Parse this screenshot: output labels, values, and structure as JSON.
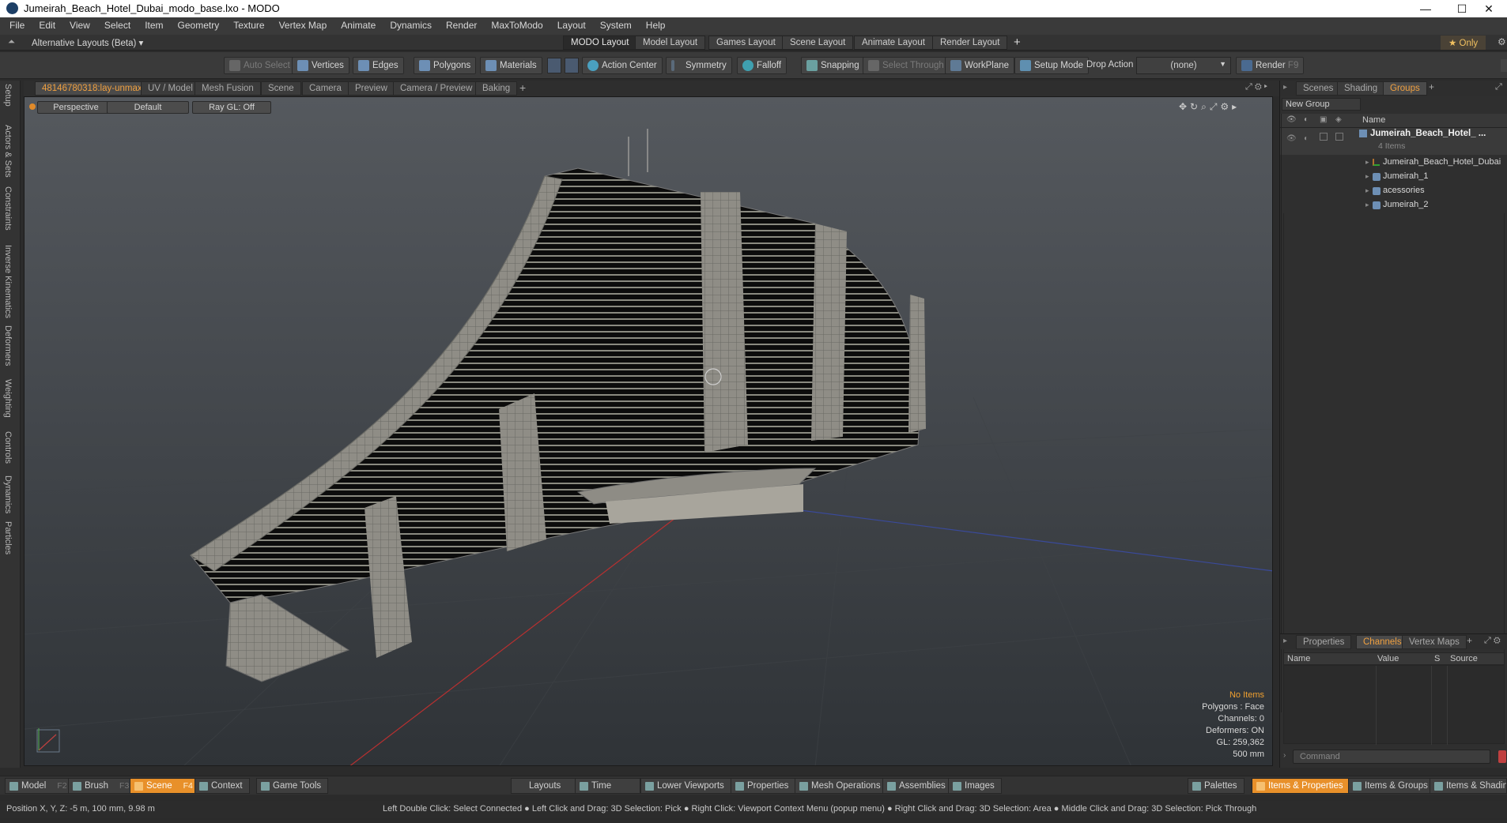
{
  "window": {
    "title": "Jumeirah_Beach_Hotel_Dubai_modo_base.lxo - MODO",
    "min_symbol": "—",
    "max_symbol": "☐",
    "close_symbol": "✕"
  },
  "menu": [
    "File",
    "Edit",
    "View",
    "Select",
    "Item",
    "Geometry",
    "Texture",
    "Vertex Map",
    "Animate",
    "Dynamics",
    "Render",
    "MaxToModo",
    "Layout",
    "System",
    "Help"
  ],
  "layouts": {
    "alt_label": "Alternative Layouts (Beta) ▾",
    "tabs": [
      "MODO Layout",
      "Model Layout",
      "Games Layout",
      "Scene Layout",
      "Animate Layout",
      "Render Layout"
    ],
    "active": "MODO Layout",
    "add": "+",
    "only_label": "★ Only"
  },
  "toolbar": {
    "auto_select": "Auto Select",
    "vertices": "Vertices",
    "edges": "Edges",
    "polygons": "Polygons",
    "materials": "Materials",
    "action_center": "Action Center",
    "symmetry": "Symmetry",
    "falloff": "Falloff",
    "snapping": "Snapping",
    "select_through": "Select Through",
    "workplane": "WorkPlane",
    "setup_mode": "Setup Mode",
    "drop_action": "Drop Action",
    "drop_value": "(none)",
    "render": "Render",
    "render_key": "F9"
  },
  "viewport_tabs": {
    "tabs": [
      "48146780318:lay-unmax",
      "UV / Model",
      "Mesh Fusion",
      "Scene",
      "Camera",
      "Preview",
      "Camera / Preview",
      "Baking"
    ],
    "add": "+"
  },
  "viewport": {
    "perspective": "Perspective",
    "default": "Default",
    "raygl": "Ray GL: Off",
    "info": {
      "selection": "No Items",
      "polygons": "Polygons : Face",
      "channels": "Channels: 0",
      "deformers": "Deformers: ON",
      "gl": "GL: 259,362",
      "scale": "500 mm"
    }
  },
  "left_tabs": [
    "Setup",
    "Actors & Sets",
    "Constraints",
    "Inverse Kinematics",
    "Deformers",
    "Weighting",
    "Controls",
    "Dynamics",
    "Particles"
  ],
  "scene_panel": {
    "tabs": [
      "Scenes",
      "Shading",
      "Groups"
    ],
    "active": "Groups",
    "new_group": "New Group",
    "col_name": "Name",
    "root": "Jumeirah_Beach_Hotel_ ...",
    "root_count": "4 Items",
    "children": [
      "Jumeirah_Beach_Hotel_Dubai",
      "Jumeirah_1",
      "acessories",
      "Jumeirah_2"
    ]
  },
  "props_panel": {
    "tabs": [
      "Properties",
      "Channels",
      "Vertex Maps"
    ],
    "active": "Channels",
    "columns": [
      "Name",
      "Value",
      "S",
      "Source"
    ],
    "command_placeholder": "Command"
  },
  "bottom": {
    "model": "Model",
    "model_key": "F2",
    "brush": "Brush",
    "brush_key": "F3",
    "scene": "Scene",
    "scene_key": "F4",
    "context": "Context",
    "game_tools": "Game Tools",
    "layouts": "Layouts",
    "time": "Time",
    "lower_viewports": "Lower Viewports",
    "properties": "Properties",
    "mesh_operations": "Mesh Operations",
    "assemblies": "Assemblies",
    "images": "Images",
    "palettes": "Palettes",
    "items_props": "Items & Properties",
    "items_groups": "Items & Groups",
    "items_shading": "Items & Shading"
  },
  "status": {
    "position": "Position X, Y, Z:   -5 m, 100 mm, 9.98 m",
    "hints": "Left Double Click: Select Connected ● Left Click and Drag: 3D Selection: Pick ● Right Click: Viewport Context Menu (popup menu) ● Right Click and Drag: 3D Selection: Area ● Middle Click and Drag: 3D Selection: Pick Through"
  },
  "colors": {
    "accent": "#f0a040",
    "active_button": "#e8902a",
    "info_highlight": "#f0a030"
  }
}
